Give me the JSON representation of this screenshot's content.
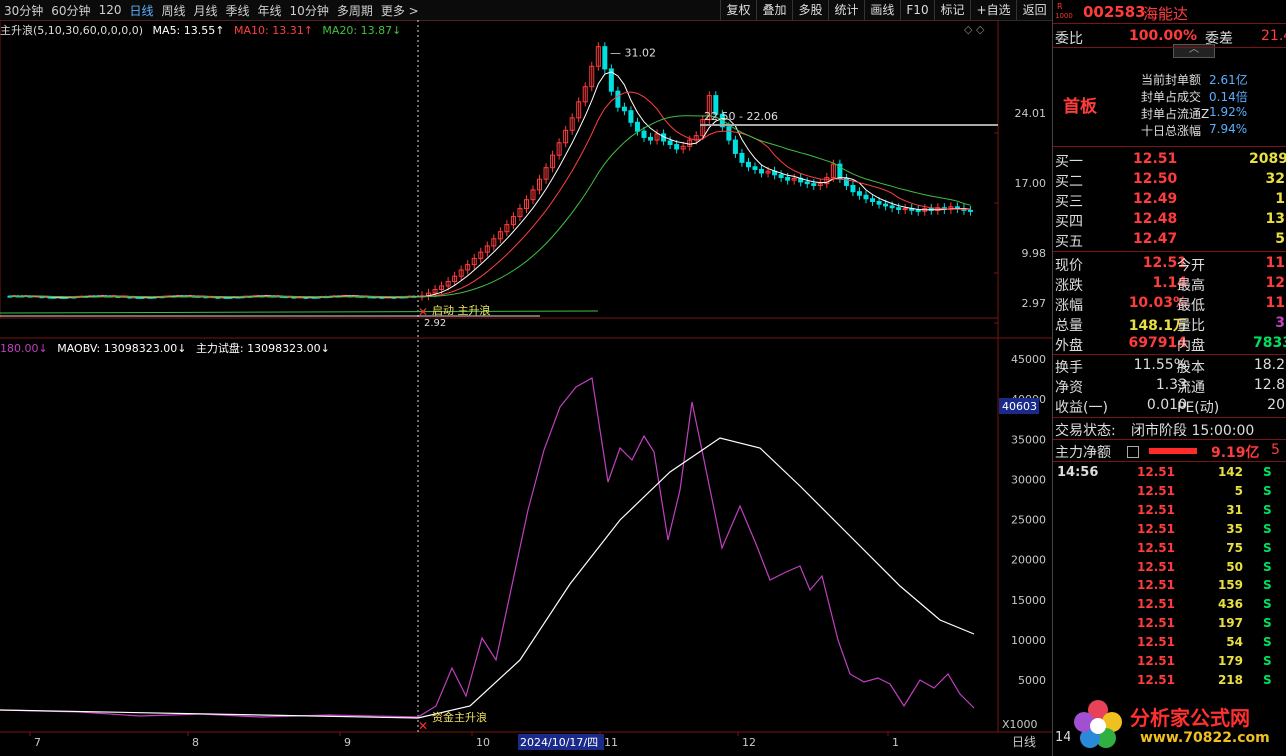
{
  "toolbar": {
    "timeframes": [
      {
        "label": "30分钟",
        "active": false
      },
      {
        "label": "60分钟",
        "active": false
      },
      {
        "label": "120",
        "active": false
      },
      {
        "label": "日线",
        "active": true
      },
      {
        "label": "周线",
        "active": false
      },
      {
        "label": "月线",
        "active": false
      },
      {
        "label": "季线",
        "active": false
      },
      {
        "label": "年线",
        "active": false
      },
      {
        "label": "10分钟",
        "active": false
      },
      {
        "label": "多周期",
        "active": false
      },
      {
        "label": "更多 >",
        "active": false
      }
    ],
    "tools": [
      "复权",
      "叠加",
      "多股",
      "统计",
      "画线",
      "F10",
      "标记",
      "+自选",
      "返回"
    ]
  },
  "main_chart": {
    "indicator_name": "主升浪(5,10,30,60,0,0,0,0)",
    "ma5": "MA5: 13.55↑",
    "ma10": "MA10: 13.31↑",
    "ma20": "MA20: 13.87↓",
    "peak_label": "31.02",
    "range_label": "22.50 - 22.06",
    "signal_label": "启动 主升浪",
    "low_label": "2.92",
    "y_ticks": [
      "24.01",
      "17.00",
      "9.98",
      "2.97"
    ]
  },
  "sub_chart": {
    "obv_legend": "180.00↓",
    "maobv_legend": "MAOBV: 13098323.00↓",
    "main_force_legend": "主力试盘: 13098323.00↓",
    "signal_label": "资金主升浪",
    "y_ticks": [
      "45000",
      "40000",
      "35000",
      "30000",
      "25000",
      "20000",
      "15000",
      "10000",
      "5000"
    ],
    "highlight_value": "40603",
    "unit": "X1000"
  },
  "x_axis": {
    "labels": [
      "7",
      "8",
      "9",
      "10",
      "2024/10/17/四",
      "11",
      "12",
      "1"
    ],
    "period": "日线"
  },
  "colors": {
    "up": "#ff3c3c",
    "down": "#00e0e0",
    "ma5": "#ffffff",
    "ma10": "#ff4040",
    "ma20": "#40c040",
    "obv": "#c040c0",
    "maobv": "#ffffff",
    "quote": "#ff3c3c",
    "buy": "#00e060",
    "accent": "#5ab0ff"
  },
  "quote_panel": {
    "code": "002583",
    "name": "海能达",
    "wei_bi_label": "委比",
    "wei_bi_value": "100.00%",
    "wei_cha_label": "委差",
    "wei_cha_value": "21.4",
    "board_tag": "首板",
    "seal_info": [
      {
        "label": "当前封单额",
        "value": "2.61亿"
      },
      {
        "label": "封单占成交",
        "value": "0.14倍"
      },
      {
        "label": "封单占流通Z",
        "value": "1.92%"
      },
      {
        "label": "十日总涨幅",
        "value": "7.94%"
      }
    ],
    "bids": [
      {
        "label": "买一",
        "price": "12.51",
        "vol": "2089"
      },
      {
        "label": "买二",
        "price": "12.50",
        "vol": "32"
      },
      {
        "label": "买三",
        "price": "12.49",
        "vol": "1"
      },
      {
        "label": "买四",
        "price": "12.48",
        "vol": "13"
      },
      {
        "label": "买五",
        "price": "12.47",
        "vol": "5"
      }
    ],
    "stats": [
      {
        "l1": "现价",
        "v1": "12.51",
        "l2": "今开",
        "v2": "11"
      },
      {
        "l1": "涨跌",
        "v1": "1.14",
        "l2": "最高",
        "v2": "12"
      },
      {
        "l1": "涨幅",
        "v1": "10.03%",
        "l2": "最低",
        "v2": "11"
      },
      {
        "l1": "总量",
        "v1": "148.1万",
        "l2": "量比",
        "v2": "3"
      },
      {
        "l1": "外盘",
        "v1": "697914",
        "l2": "内盘",
        "v2": "7833"
      }
    ],
    "stats2": [
      {
        "l1": "换手",
        "v1": "11.55%",
        "l2": "股本",
        "v2": "18.2"
      },
      {
        "l1": "净资",
        "v1": "1.33",
        "l2": "流通",
        "v2": "12.8"
      },
      {
        "l1": "收益(一)",
        "v1": "0.010",
        "l2": "PE(动)",
        "v2": "20"
      }
    ],
    "trade_status_label": "交易状态:",
    "trade_status_value": "闭市阶段 15:00:00",
    "net_flow_label": "主力净额",
    "net_flow_value": "9.19亿",
    "net_flow_extra": "5",
    "ticks_time": "14:56",
    "ticks": [
      {
        "price": "12.51",
        "vol": "142",
        "side": "S"
      },
      {
        "price": "12.51",
        "vol": "5",
        "side": "S"
      },
      {
        "price": "12.51",
        "vol": "31",
        "side": "S"
      },
      {
        "price": "12.51",
        "vol": "35",
        "side": "S"
      },
      {
        "price": "12.51",
        "vol": "75",
        "side": "S"
      },
      {
        "price": "12.51",
        "vol": "50",
        "side": "S"
      },
      {
        "price": "12.51",
        "vol": "159",
        "side": "S"
      },
      {
        "price": "12.51",
        "vol": "436",
        "side": "S"
      },
      {
        "price": "12.51",
        "vol": "197",
        "side": "S"
      },
      {
        "price": "12.51",
        "vol": "54",
        "side": "S"
      },
      {
        "price": "12.51",
        "vol": "179",
        "side": "S"
      },
      {
        "price": "12.51",
        "vol": "218",
        "side": "S"
      }
    ],
    "bottom_left": "14"
  },
  "watermark": {
    "text": "分析家公式网",
    "url": "www.70822.com"
  }
}
